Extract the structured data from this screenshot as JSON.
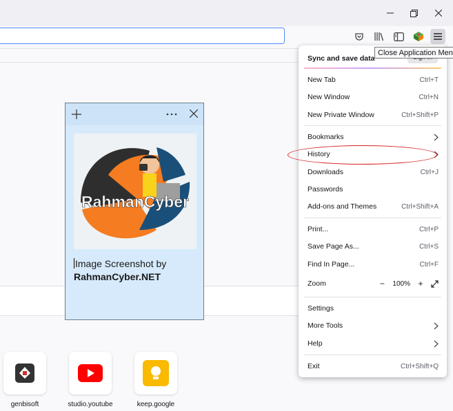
{
  "toolbar": {
    "tooltip": "Close Application Menu"
  },
  "menu": {
    "sync_label": "Sync and save data",
    "signin_label": "Sign In",
    "items": {
      "new_tab": {
        "label": "New Tab",
        "shortcut": "Ctrl+T"
      },
      "new_window": {
        "label": "New Window",
        "shortcut": "Ctrl+N"
      },
      "new_private_window": {
        "label": "New Private Window",
        "shortcut": "Ctrl+Shift+P"
      },
      "bookmarks": {
        "label": "Bookmarks"
      },
      "history": {
        "label": "History"
      },
      "downloads": {
        "label": "Downloads",
        "shortcut": "Ctrl+J"
      },
      "passwords": {
        "label": "Passwords"
      },
      "addons": {
        "label": "Add-ons and Themes",
        "shortcut": "Ctrl+Shift+A"
      },
      "print": {
        "label": "Print...",
        "shortcut": "Ctrl+P"
      },
      "save_page": {
        "label": "Save Page As...",
        "shortcut": "Ctrl+S"
      },
      "find": {
        "label": "Find In Page...",
        "shortcut": "Ctrl+F"
      },
      "zoom": {
        "label": "Zoom",
        "value": "100%"
      },
      "settings": {
        "label": "Settings"
      },
      "more_tools": {
        "label": "More Tools"
      },
      "help": {
        "label": "Help"
      },
      "exit": {
        "label": "Exit",
        "shortcut": "Ctrl+Shift+Q"
      }
    }
  },
  "note": {
    "line1": "Image Screenshot by",
    "line2": "RahmanCyber.NET",
    "logo_text": "RahmanCyber"
  },
  "shortcuts": [
    {
      "label": "genbisoft"
    },
    {
      "label": "studio.youtube"
    },
    {
      "label": "keep.google"
    }
  ],
  "colors": {
    "accent": "#4d88ff",
    "annotation": "#d41f1f",
    "note_bg": "#d6eafb"
  }
}
